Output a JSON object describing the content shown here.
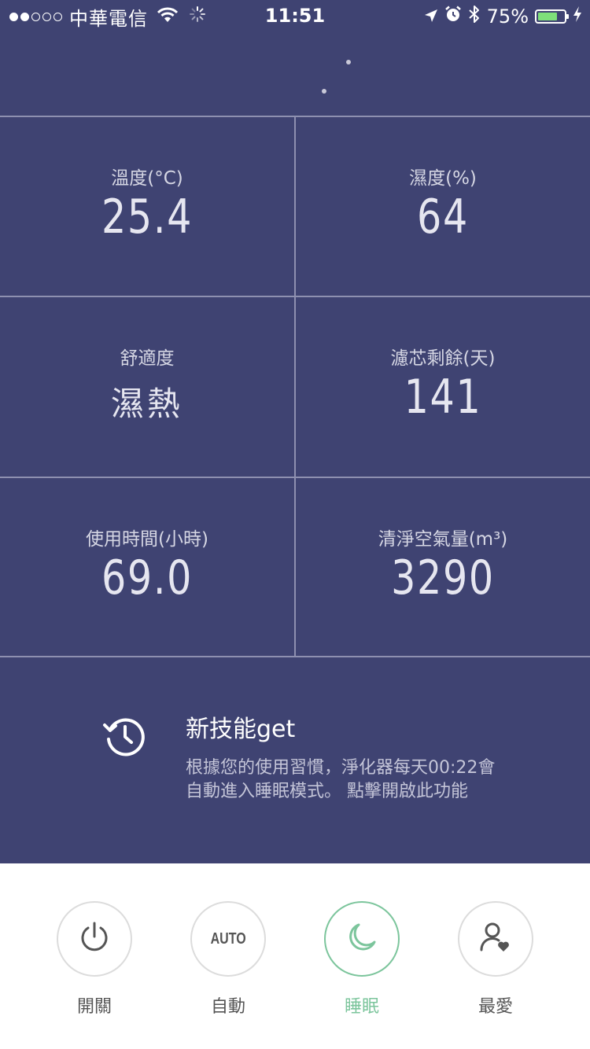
{
  "status_bar": {
    "carrier": "中華電信",
    "time": "11:51",
    "battery": "75%",
    "battery_level": 0.75,
    "signal_bars": 2,
    "signal_total": 5
  },
  "stats": {
    "temperature": {
      "label": "溫度(°C)",
      "value": "25.4"
    },
    "humidity": {
      "label": "濕度(%)",
      "value": "64"
    },
    "comfort": {
      "label": "舒適度",
      "value": "濕熱"
    },
    "filter": {
      "label": "濾芯剩餘(天)",
      "value": "141"
    },
    "usage": {
      "label": "使用時間(小時)",
      "value": "69.0"
    },
    "clean_air": {
      "label": "清淨空氣量(m³)",
      "value": "3290"
    }
  },
  "skill": {
    "title": "新技能get",
    "description_line1": "根據您的使用習慣，淨化器每天00:22會",
    "description_line2": "自動進入睡眠模式。 點擊開啟此功能"
  },
  "modes": [
    {
      "label": "開關",
      "icon": "power-icon",
      "active": false
    },
    {
      "label": "自動",
      "icon_text": "AUTO",
      "active": false
    },
    {
      "label": "睡眠",
      "icon": "moon-icon",
      "active": true
    },
    {
      "label": "最愛",
      "icon": "user-heart-icon",
      "active": false
    }
  ],
  "colors": {
    "background": "#3f4372",
    "accent": "#7cc59c",
    "divider": "#8e90b0"
  }
}
